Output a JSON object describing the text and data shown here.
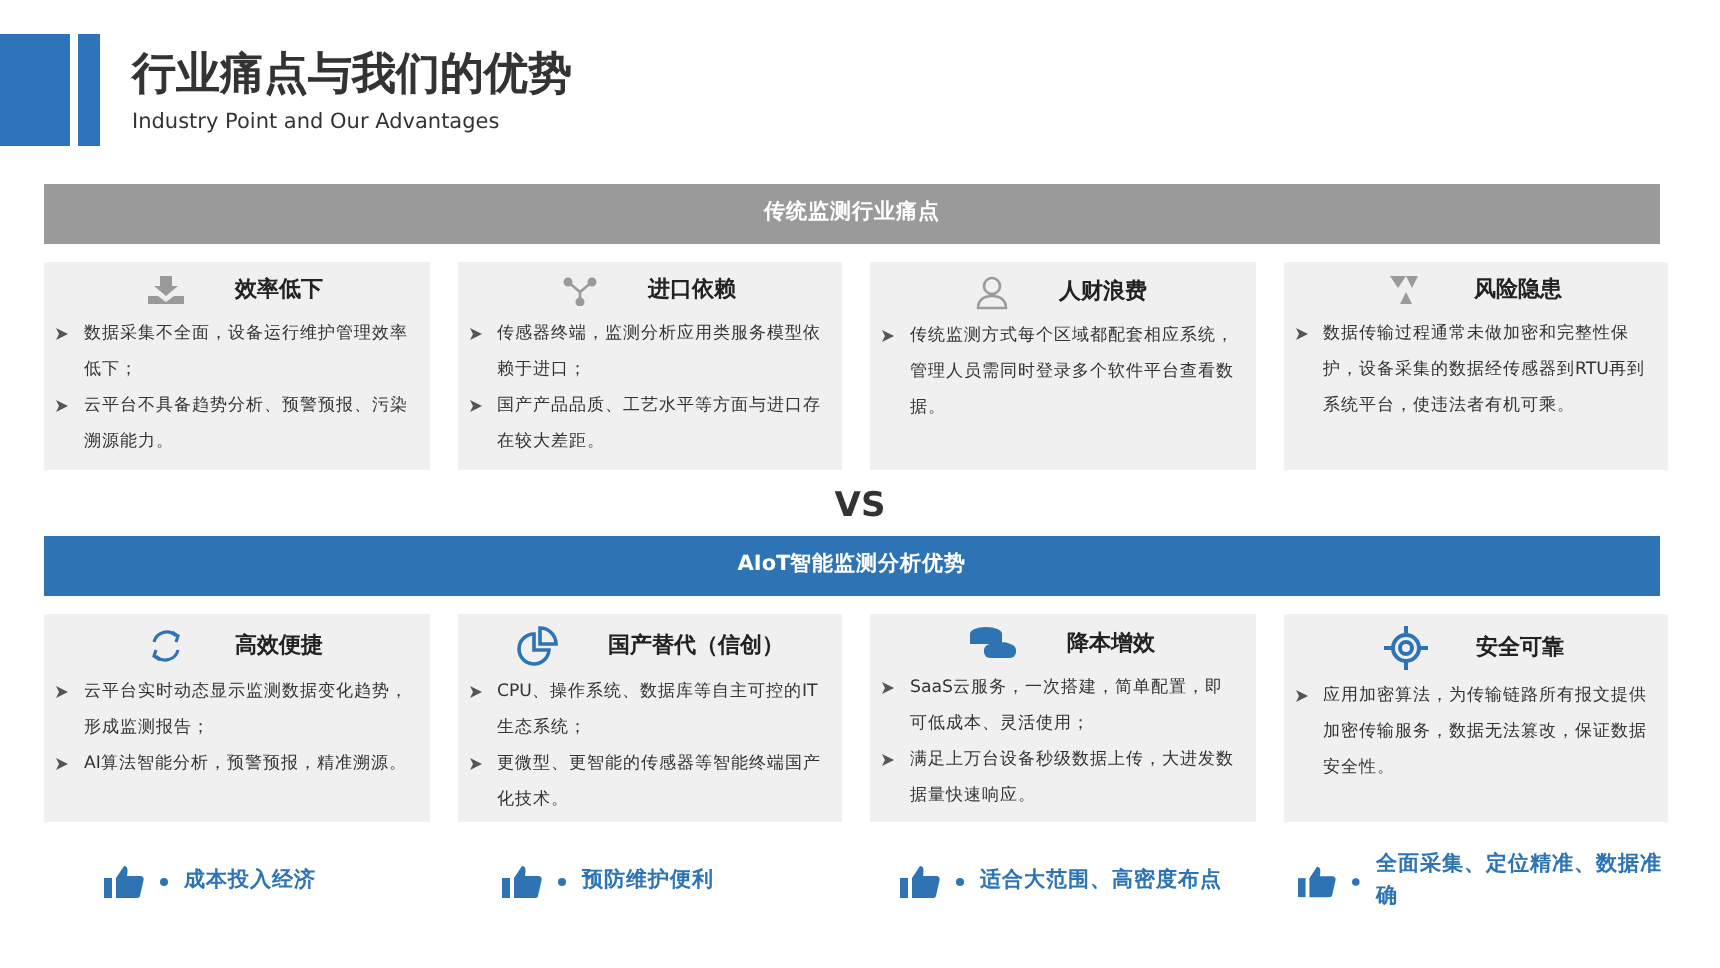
{
  "header": {
    "title": "行业痛点与我们的优势",
    "subtitle": "Industry Point and Our Advantages"
  },
  "pain_points": {
    "banner": "传统监测行业痛点",
    "cards": [
      {
        "title": "效率低下",
        "points": [
          "数据采集不全面，设备运行维护管理效率低下；",
          "云平台不具备趋势分析、预警预报、污染溯源能力。"
        ]
      },
      {
        "title": "进口依赖",
        "points": [
          "传感器终端，监测分析应用类服务模型依赖于进口；",
          "国产产品品质、工艺水平等方面与进口存在较大差距。"
        ]
      },
      {
        "title": "人财浪费",
        "points": [
          "传统监测方式每个区域都配套相应系统，管理人员需同时登录多个软件平台查看数据。"
        ]
      },
      {
        "title": "风险隐患",
        "points": [
          "数据传输过程通常未做加密和完整性保护，设备采集的数据经传感器到RTU再到系统平台，使违法者有机可乘。"
        ]
      }
    ]
  },
  "vs": "VS",
  "advantages": {
    "banner": "AIoT智能监测分析优势",
    "cards": [
      {
        "title": "高效便捷",
        "points": [
          "云平台实时动态显示监测数据变化趋势，形成监测报告；",
          "AI算法智能分析，预警预报，精准溯源。"
        ]
      },
      {
        "title": "国产替代（信创）",
        "points": [
          "CPU、操作系统、数据库等自主可控的IT生态系统；",
          "更微型、更智能的传感器等智能终端国产化技术。"
        ]
      },
      {
        "title": "降本增效",
        "points": [
          "SaaS云服务，一次搭建，简单配置，即可低成本、灵活使用；",
          "满足上万台设备秒级数据上传，大进发数据量快速响应。"
        ]
      },
      {
        "title": "安全可靠",
        "points": [
          "应用加密算法，为传输链路所有报文提供加密传输服务，数据无法篡改，保证数据安全性。"
        ]
      }
    ]
  },
  "highlights": [
    "成本投入经济",
    "预防维护便利",
    "适合大范围、高密度布点",
    "全面采集、定位精准、数据准确"
  ]
}
